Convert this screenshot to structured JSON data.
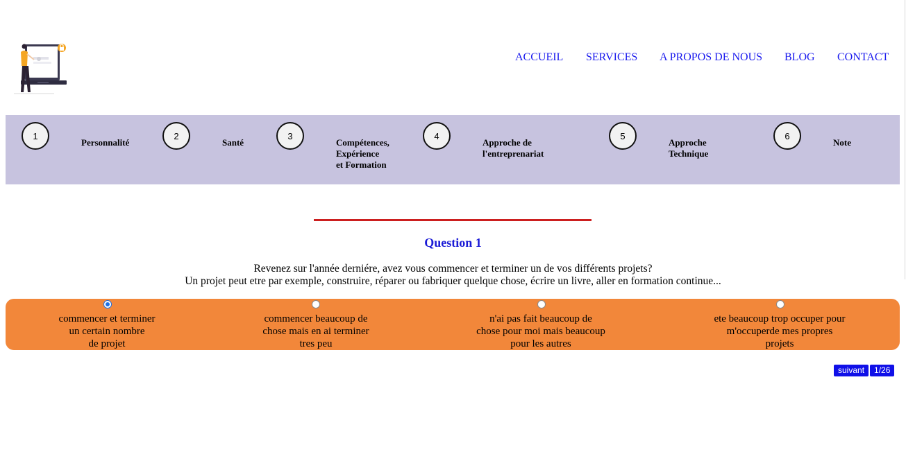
{
  "nav": {
    "items": [
      "ACCUEIL",
      "SERVICES",
      "A PROPOS DE NOUS",
      "BLOG",
      "CONTACT"
    ]
  },
  "steps": [
    {
      "number": "1",
      "label": "Personnalité"
    },
    {
      "number": "2",
      "label": "Santé"
    },
    {
      "number": "3",
      "label": "Compétences,\nExpérience\net Formation"
    },
    {
      "number": "4",
      "label": "Approche de\nl'entreprenariat"
    },
    {
      "number": "5",
      "label": "Approche\nTechnique"
    },
    {
      "number": "6",
      "label": "Note"
    }
  ],
  "question": {
    "title": "Question 1",
    "line1": "Revenez sur l'année derniére, avez vous commencer et terminer un de vos différents projets?",
    "line2": "Un projet peut etre par exemple, construire, réparer ou fabriquer quelque chose, écrire un livre, aller en formation continue..."
  },
  "answers": [
    {
      "label": "commencer et terminer\nun certain nombre\nde projet",
      "selected": true
    },
    {
      "label": "commencer beaucoup de\nchose mais en ai terminer\ntres peu",
      "selected": false
    },
    {
      "label": "n'ai pas fait beaucoup de\nchose pour moi mais beaucoup\npour les autres",
      "selected": false
    },
    {
      "label": "ete beaucoup trop occuper pour\nm'occuperde mes propres\nprojets",
      "selected": false
    }
  ],
  "pager": {
    "next_label": "suivant",
    "page": "1/26"
  },
  "colors": {
    "nav_link": "#1a1aee",
    "steps_bg": "#c7c3df",
    "answers_bg": "#f2873a",
    "question_title": "#1a1ad6",
    "divider": "#cc1f1f",
    "pager_bg": "#1010e8"
  },
  "icons": {
    "logo": "woman-with-laptop-lock-illustration"
  }
}
